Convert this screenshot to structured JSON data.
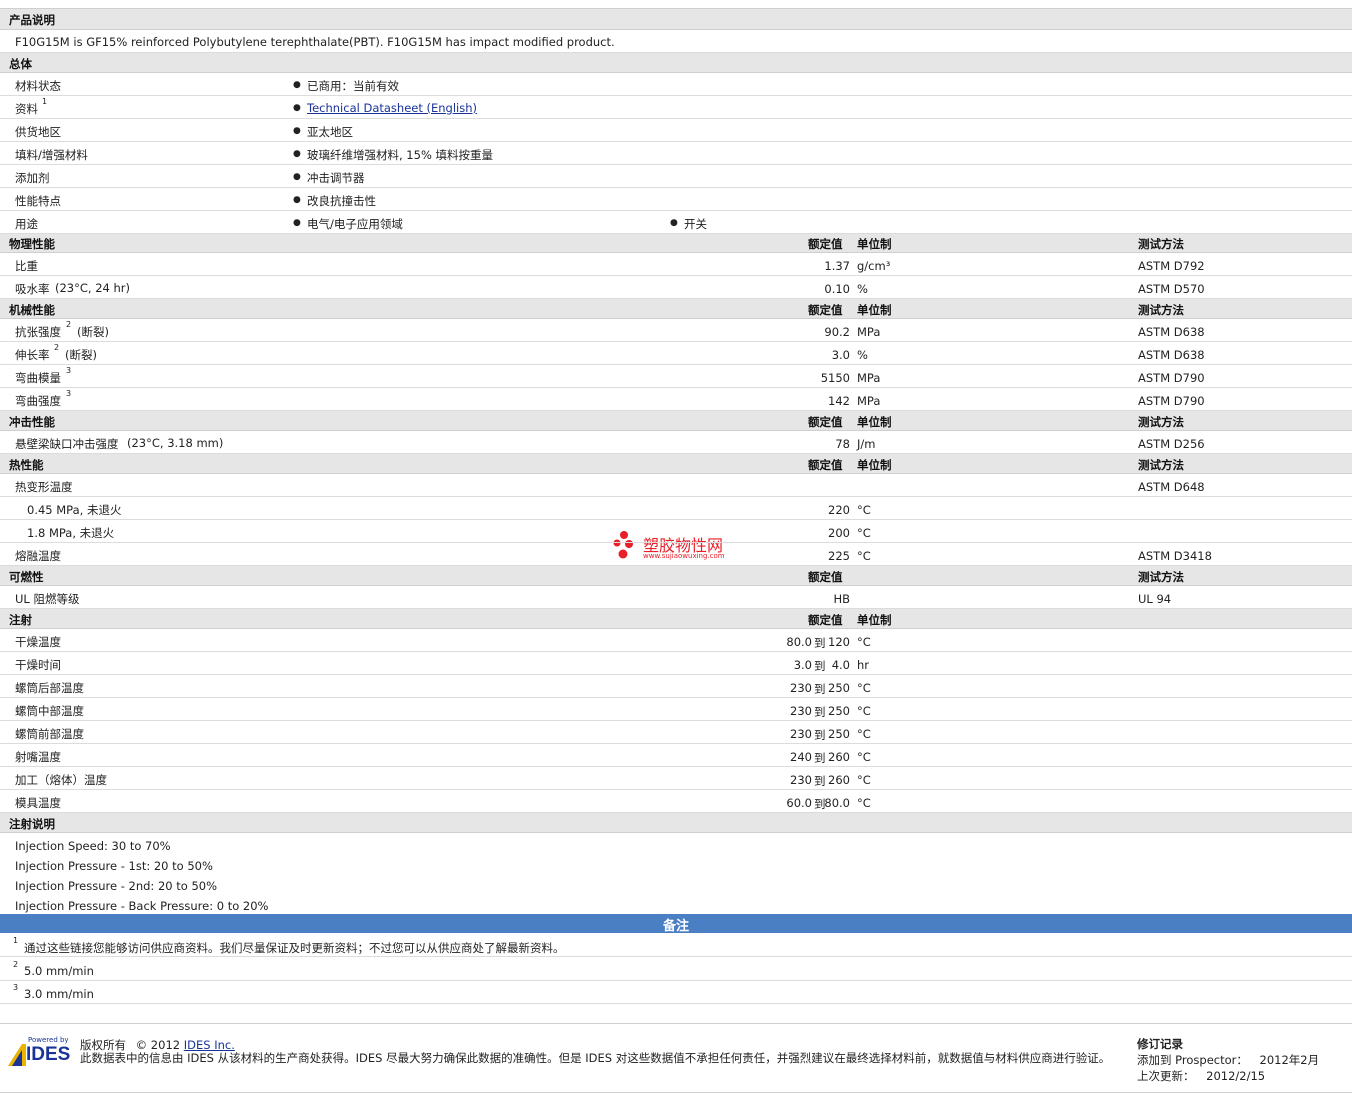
{
  "desc": {
    "title": "产品说明",
    "text": "F10G15M is GF15% reinforced Polybutylene terephthalate(PBT). F10G15M has impact modified product."
  },
  "general": {
    "title": "总体",
    "rows": [
      {
        "label": "材料状态",
        "sup": "",
        "items": [
          "已商用：当前有效"
        ]
      },
      {
        "label": "资料",
        "sup": "1",
        "items": [
          "Technical Datasheet (English)"
        ]
      },
      {
        "label": "供货地区",
        "sup": "",
        "items": [
          "亚太地区"
        ]
      },
      {
        "label": "填料/增强材料",
        "sup": "",
        "items": [
          "玻璃纤维增强材料, 15% 填料按重量"
        ]
      },
      {
        "label": "添加剂",
        "sup": "",
        "items": [
          "冲击调节器"
        ]
      },
      {
        "label": "性能特点",
        "sup": "",
        "items": [
          "改良抗撞击性"
        ]
      },
      {
        "label": "用途",
        "sup": "",
        "items": [
          "电气/电子应用领域",
          "开关"
        ]
      }
    ]
  },
  "headers": {
    "nominal": "额定值",
    "unit": "单位制",
    "method": "测试方法"
  },
  "physical": {
    "title": "物理性能",
    "rows": [
      {
        "label": "比重",
        "sup": "",
        "suffix": "",
        "value": "1.37",
        "unit": "g/cm³",
        "method": "ASTM D792"
      },
      {
        "label": "吸水率",
        "sup": "",
        "suffix": "(23°C, 24 hr)",
        "value": "0.10",
        "unit": "%",
        "method": "ASTM D570"
      }
    ]
  },
  "mechanical": {
    "title": "机械性能",
    "rows": [
      {
        "label": "抗张强度",
        "sup": "2",
        "suffix": "(断裂)",
        "value": "90.2",
        "unit": "MPa",
        "method": "ASTM D638"
      },
      {
        "label": "伸长率",
        "sup": "2",
        "suffix": "(断裂)",
        "value": "3.0",
        "unit": "%",
        "method": "ASTM D638"
      },
      {
        "label": "弯曲模量",
        "sup": "3",
        "suffix": "",
        "value": "5150",
        "unit": "MPa",
        "method": "ASTM D790"
      },
      {
        "label": "弯曲强度",
        "sup": "3",
        "suffix": "",
        "value": "142",
        "unit": "MPa",
        "method": "ASTM D790"
      }
    ]
  },
  "impact": {
    "title": "冲击性能",
    "rows": [
      {
        "label": "悬壁梁缺口冲击强度",
        "sup": "",
        "suffix": "(23°C, 3.18 mm)",
        "value": "78",
        "unit": "J/m",
        "method": "ASTM D256"
      }
    ]
  },
  "thermal": {
    "title": "热性能",
    "rows": [
      {
        "label": "热变形温度",
        "value": "",
        "unit": "",
        "method": "ASTM D648"
      },
      {
        "label": "0.45 MPa, 未退火",
        "value": "220",
        "unit": "°C",
        "method": ""
      },
      {
        "label": "1.8 MPa, 未退火",
        "value": "200",
        "unit": "°C",
        "method": ""
      },
      {
        "label": "熔融温度",
        "value": "225",
        "unit": "°C",
        "method": "ASTM D3418"
      }
    ]
  },
  "flammability": {
    "title": "可燃性",
    "rows": [
      {
        "label": "UL 阻燃等级",
        "value": "HB",
        "method": "UL 94"
      }
    ]
  },
  "injection": {
    "title": "注射",
    "to": "到",
    "rows": [
      {
        "label": "干燥温度",
        "low": "80.0",
        "high": "120",
        "unit": "°C"
      },
      {
        "label": "干燥时间",
        "low": "3.0",
        "high": "4.0",
        "unit": "hr"
      },
      {
        "label": "螺筒后部温度",
        "low": "230",
        "high": "250",
        "unit": "°C"
      },
      {
        "label": "螺筒中部温度",
        "low": "230",
        "high": "250",
        "unit": "°C"
      },
      {
        "label": "螺筒前部温度",
        "low": "230",
        "high": "250",
        "unit": "°C"
      },
      {
        "label": "射嘴温度",
        "low": "240",
        "high": "260",
        "unit": "°C"
      },
      {
        "label": "加工（熔体）温度",
        "low": "230",
        "high": "260",
        "unit": "°C"
      },
      {
        "label": "模具温度",
        "low": "60.0",
        "high": "80.0",
        "unit": "°C"
      }
    ]
  },
  "inj_notes": {
    "title": "注射说明",
    "lines": [
      "Injection Speed: 30 to 70%",
      "Injection Pressure - 1st: 20 to 50%",
      "Injection Pressure - 2nd: 20 to 50%",
      "Injection Pressure - Back Pressure: 0 to 20%"
    ]
  },
  "notes": {
    "title": "备注",
    "items": [
      {
        "num": "1",
        "text": "通过这些链接您能够访问供应商资料。我们尽量保证及时更新资料；不过您可以从供应商处了解最新资料。"
      },
      {
        "num": "2",
        "text": "5.0 mm/min"
      },
      {
        "num": "3",
        "text": "3.0 mm/min"
      }
    ]
  },
  "footer": {
    "powered_by": "Powered by",
    "logo_text": "IDES",
    "copyright_label": "版权所有",
    "copyright_year": "© 2012",
    "company": "IDES Inc.",
    "disclaimer": "此数据表中的信息由 IDES 从该材料的生产商处获得。IDES 尽最大努力确保此数据的准确性。但是 IDES 对这些数据值不承担任何责任，并强烈建议在最终选择材料前，就数据值与材料供应商进行验证。",
    "rev_title": "修订记录",
    "added_label": "添加到 Prospector：",
    "added_value": "2012年2月",
    "updated_label": "上次更新：",
    "updated_value": "2012/2/15"
  },
  "watermark": {
    "text": "塑胶物性网",
    "url": "www.sujiaowuxing.com",
    "color": "#e8202a"
  }
}
